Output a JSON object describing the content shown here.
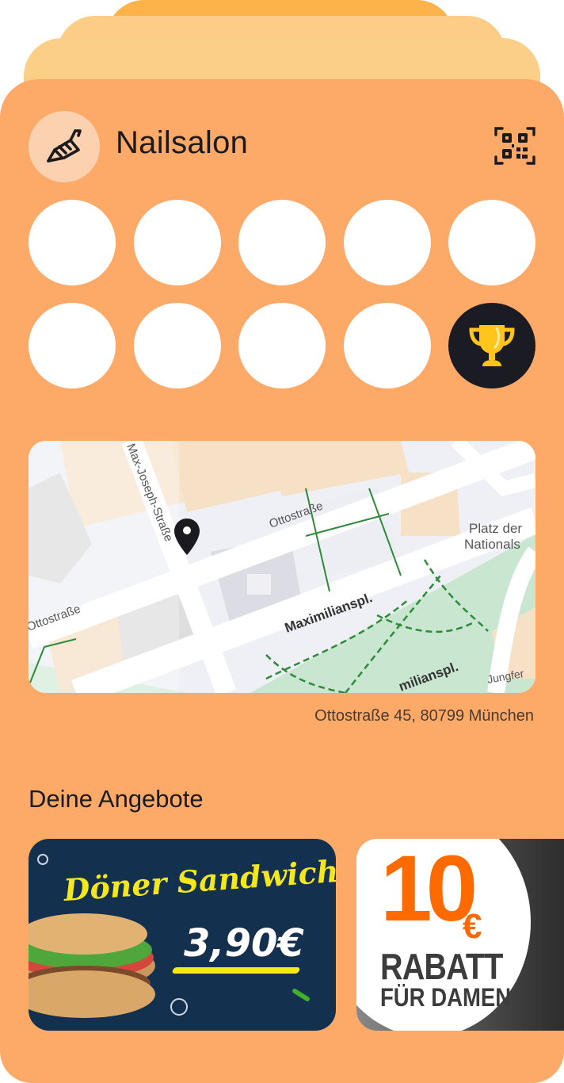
{
  "card": {
    "title": "Nailsalon",
    "logo_icon": "nail-polish-icon",
    "qr_icon": "qr-code-icon",
    "accent": "#FDAA68",
    "stamps_total": 10,
    "stamps_filled": 0,
    "reward_icon": "trophy-icon"
  },
  "map": {
    "streets": {
      "max_joseph": "Max-Joseph-Straße",
      "ottostrasse_top": "Ottostraße",
      "ottostrasse_left": "Ottostraße",
      "maximilianspl": "Maximilianspl.",
      "maximilianspl_lower": "milianspl.",
      "platz_line1": "Platz der",
      "platz_line2": "Nationals",
      "jungfern": "Jungfer"
    },
    "pin_icon": "map-pin-icon"
  },
  "address": "Ottostraße 45, 80799 München",
  "offers": {
    "title": "Deine Angebote",
    "items": [
      {
        "headline": "Döner Sandwich",
        "price": "3,90€"
      },
      {
        "amount": "10",
        "currency": "€",
        "line1": "RABATT",
        "line2": "FÜR DAMEN"
      }
    ]
  }
}
